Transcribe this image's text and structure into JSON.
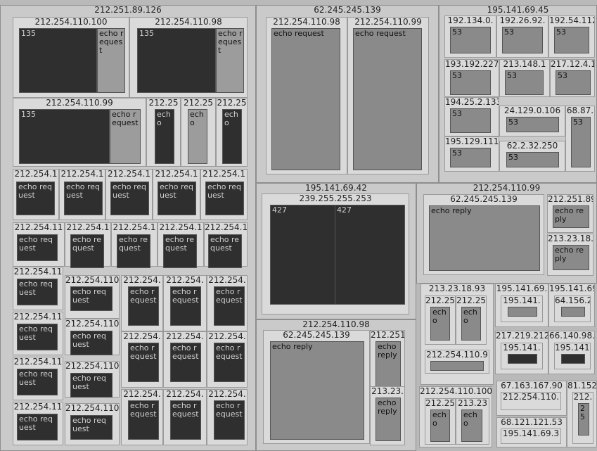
{
  "treemap": {
    "nodes": [
      {
        "label": "212.251.89.126",
        "level": 0
      },
      {
        "label": "62.245.245.139",
        "level": 0
      },
      {
        "label": "195.141.69.45",
        "level": 0
      },
      {
        "label": "195.141.69.42",
        "level": 0
      },
      {
        "label": "212.254.110.99",
        "level": 0
      },
      {
        "label": "212.254.110.98",
        "level": 0
      },
      {
        "label": "212.254.110.100",
        "level": 1
      },
      {
        "label": "135",
        "level": 2,
        "tone": "dk"
      },
      {
        "label": "echo request",
        "level": 2,
        "tone": "lt"
      },
      {
        "label": "212.254.110.98",
        "level": 1
      },
      {
        "label": "135",
        "level": 2,
        "tone": "dk"
      },
      {
        "label": "echo request",
        "level": 2,
        "tone": "lt"
      },
      {
        "label": "212.254.110.99",
        "level": 1
      },
      {
        "label": "135",
        "level": 2,
        "tone": "dk"
      },
      {
        "label": "echo request",
        "level": 2,
        "tone": "lt"
      },
      {
        "label": "212.25",
        "level": 1
      },
      {
        "label": "echo",
        "level": 2,
        "tone": "dk"
      },
      {
        "label": "212.25",
        "level": 1
      },
      {
        "label": "echo",
        "level": 2,
        "tone": "lt"
      },
      {
        "label": "212.25",
        "level": 1
      },
      {
        "label": "echo",
        "level": 2,
        "tone": "dk"
      },
      {
        "label": "212.254.1",
        "level": 1
      },
      {
        "label": "echo request",
        "level": 2,
        "tone": "dk"
      },
      {
        "label": "212.254.1",
        "level": 1
      },
      {
        "label": "echo request",
        "level": 2,
        "tone": "dk"
      },
      {
        "label": "212.254.1",
        "level": 1
      },
      {
        "label": "echo request",
        "level": 2,
        "tone": "dk"
      },
      {
        "label": "212.254.1",
        "level": 1
      },
      {
        "label": "echo request",
        "level": 2,
        "tone": "dk"
      },
      {
        "label": "212.254.1",
        "level": 1
      },
      {
        "label": "echo request",
        "level": 2,
        "tone": "dk"
      },
      {
        "label": "212.254.11",
        "level": 1
      },
      {
        "label": "echo request",
        "level": 2,
        "tone": "dk"
      },
      {
        "label": "212.254.1",
        "level": 1
      },
      {
        "label": "echo request",
        "level": 2,
        "tone": "dk"
      },
      {
        "label": "212.254.1",
        "level": 1
      },
      {
        "label": "echo request",
        "level": 2,
        "tone": "dk"
      },
      {
        "label": "212.254.1",
        "level": 1
      },
      {
        "label": "echo request",
        "level": 2,
        "tone": "dk"
      },
      {
        "label": "212.254.1",
        "level": 1
      },
      {
        "label": "echo request",
        "level": 2,
        "tone": "dk"
      },
      {
        "label": "212.254.11",
        "level": 1
      },
      {
        "label": "echo request",
        "level": 2,
        "tone": "dk"
      },
      {
        "label": "212.254.11",
        "level": 1
      },
      {
        "label": "echo request",
        "level": 2,
        "tone": "dk"
      },
      {
        "label": "212.254.11",
        "level": 1
      },
      {
        "label": "echo request",
        "level": 2,
        "tone": "dk"
      },
      {
        "label": "212.254.11",
        "level": 1
      },
      {
        "label": "echo request",
        "level": 2,
        "tone": "dk"
      },
      {
        "label": "212.254.110",
        "level": 1
      },
      {
        "label": "echo request",
        "level": 2,
        "tone": "dk"
      },
      {
        "label": "212.254.110",
        "level": 1
      },
      {
        "label": "echo request",
        "level": 2,
        "tone": "dk"
      },
      {
        "label": "212.254.110",
        "level": 1
      },
      {
        "label": "echo request",
        "level": 2,
        "tone": "dk"
      },
      {
        "label": "212.254.110",
        "level": 1
      },
      {
        "label": "echo request",
        "level": 2,
        "tone": "dk"
      },
      {
        "label": "212.254.",
        "level": 1
      },
      {
        "label": "echo request",
        "level": 2,
        "tone": "dk"
      },
      {
        "label": "212.254.",
        "level": 1
      },
      {
        "label": "echo request",
        "level": 2,
        "tone": "dk"
      },
      {
        "label": "212.254.",
        "level": 1
      },
      {
        "label": "echo request",
        "level": 2,
        "tone": "dk"
      },
      {
        "label": "212.254.",
        "level": 1
      },
      {
        "label": "echo request",
        "level": 2,
        "tone": "dk"
      },
      {
        "label": "212.254.",
        "level": 1
      },
      {
        "label": "echo request",
        "level": 2,
        "tone": "dk"
      },
      {
        "label": "212.254.",
        "level": 1
      },
      {
        "label": "echo request",
        "level": 2,
        "tone": "dk"
      },
      {
        "label": "212.254.",
        "level": 1
      },
      {
        "label": "echo request",
        "level": 2,
        "tone": "dk"
      },
      {
        "label": "212.254.",
        "level": 1
      },
      {
        "label": "echo request",
        "level": 2,
        "tone": "dk"
      },
      {
        "label": "212.254.",
        "level": 1
      },
      {
        "label": "echo request",
        "level": 2,
        "tone": "dk"
      },
      {
        "label": "212.254.110.98",
        "level": 1
      },
      {
        "label": "echo request",
        "level": 2,
        "tone": "md"
      },
      {
        "label": "212.254.110.99",
        "level": 1
      },
      {
        "label": "echo request",
        "level": 2,
        "tone": "md"
      },
      {
        "label": "192.134.0.",
        "level": 1
      },
      {
        "label": "53",
        "level": 2,
        "tone": "md"
      },
      {
        "label": "192.26.92.",
        "level": 1
      },
      {
        "label": "53",
        "level": 2,
        "tone": "md"
      },
      {
        "label": "192.54.112",
        "level": 1
      },
      {
        "label": "53",
        "level": 2,
        "tone": "md"
      },
      {
        "label": "193.192.227.",
        "level": 1
      },
      {
        "label": "53",
        "level": 2,
        "tone": "md"
      },
      {
        "label": "213.148.1",
        "level": 1
      },
      {
        "label": "53",
        "level": 2,
        "tone": "md"
      },
      {
        "label": "217.12.4.1",
        "level": 1
      },
      {
        "label": "53",
        "level": 2,
        "tone": "md"
      },
      {
        "label": "194.25.2.133",
        "level": 1
      },
      {
        "label": "53",
        "level": 2,
        "tone": "md"
      },
      {
        "label": "24.129.0.106",
        "level": 1
      },
      {
        "label": "53",
        "level": 2,
        "tone": "md"
      },
      {
        "label": "68.87.",
        "level": 1
      },
      {
        "label": "53",
        "level": 2,
        "tone": "md"
      },
      {
        "label": "195.129.111.",
        "level": 1
      },
      {
        "label": "53",
        "level": 2,
        "tone": "md"
      },
      {
        "label": "62.2.32.250",
        "level": 1
      },
      {
        "label": "53",
        "level": 2,
        "tone": "md"
      },
      {
        "label": "239.255.255.253",
        "level": 1
      },
      {
        "label": "427",
        "level": 2,
        "tone": "dk"
      },
      {
        "label": "427",
        "level": 2,
        "tone": "dk"
      },
      {
        "label": "62.245.245.139",
        "level": 1
      },
      {
        "label": "echo reply",
        "level": 2,
        "tone": "md"
      },
      {
        "label": "212.251.89",
        "level": 1
      },
      {
        "label": "echo reply",
        "level": 2,
        "tone": "md"
      },
      {
        "label": "213.23.18.",
        "level": 1
      },
      {
        "label": "echo reply",
        "level": 2,
        "tone": "md"
      },
      {
        "label": "213.23.18.93",
        "level": 1
      },
      {
        "label": "212.25",
        "level": 1
      },
      {
        "label": "echo",
        "level": 2,
        "tone": "md"
      },
      {
        "label": "212.25",
        "level": 1
      },
      {
        "label": "echo",
        "level": 2,
        "tone": "md"
      },
      {
        "label": "212.254.110.9",
        "level": 1
      },
      {
        "label": "",
        "level": 2,
        "tone": "md"
      },
      {
        "label": "195.141.69.",
        "level": 1
      },
      {
        "label": "195.141.",
        "level": 1
      },
      {
        "label": "",
        "level": 2,
        "tone": "md"
      },
      {
        "label": "195.141.69",
        "level": 1
      },
      {
        "label": "64.156.2",
        "level": 1
      },
      {
        "label": "",
        "level": 2,
        "tone": "md"
      },
      {
        "label": "217.219.212",
        "level": 1
      },
      {
        "label": "195.141.",
        "level": 1
      },
      {
        "label": "",
        "level": 2,
        "tone": "dk"
      },
      {
        "label": "66.140.98.",
        "level": 1
      },
      {
        "label": "195.141.",
        "level": 1
      },
      {
        "label": "",
        "level": 2,
        "tone": "dk"
      },
      {
        "label": "212.254.110.100",
        "level": 1
      },
      {
        "label": "212.25",
        "level": 1
      },
      {
        "label": "echo",
        "level": 2,
        "tone": "md"
      },
      {
        "label": "213.23",
        "level": 1
      },
      {
        "label": "echo",
        "level": 2,
        "tone": "md"
      },
      {
        "label": "67.163.167.90",
        "level": 1
      },
      {
        "label": "212.254.110.",
        "level": 1
      },
      {
        "label": "81.152",
        "level": 1
      },
      {
        "label": "212.",
        "level": 1
      },
      {
        "label": "25",
        "level": 2,
        "tone": "md"
      },
      {
        "label": "68.121.121.53",
        "level": 1
      },
      {
        "label": "195.141.69.3",
        "level": 1
      },
      {
        "label": "62.245.245.139",
        "level": 1
      },
      {
        "label": "echo reply",
        "level": 2,
        "tone": "md"
      },
      {
        "label": "212.251",
        "level": 1
      },
      {
        "label": "echo reply",
        "level": 2,
        "tone": "md"
      },
      {
        "label": "213.23.",
        "level": 1
      },
      {
        "label": "echo reply",
        "level": 2,
        "tone": "md"
      }
    ]
  }
}
